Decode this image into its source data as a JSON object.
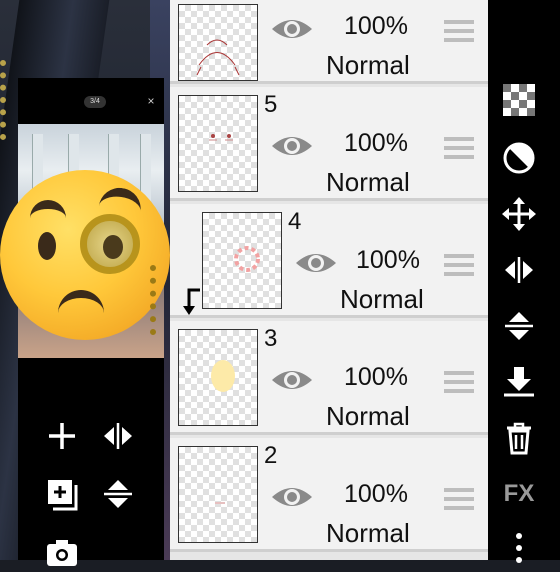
{
  "popup": {
    "counter": "3/4",
    "close_symbol": "×"
  },
  "layers": [
    {
      "number": "",
      "opacity": "100%",
      "blend": "Normal",
      "icon": "eye-icon"
    },
    {
      "number": "5",
      "opacity": "100%",
      "blend": "Normal",
      "icon": "eye-icon"
    },
    {
      "number": "4",
      "opacity": "100%",
      "blend": "Normal",
      "icon": "eye-icon",
      "clipped": true
    },
    {
      "number": "3",
      "opacity": "100%",
      "blend": "Normal",
      "icon": "eye-icon"
    },
    {
      "number": "2",
      "opacity": "100%",
      "blend": "Normal",
      "icon": "eye-icon"
    }
  ],
  "sidebar": {
    "fx_label": "FX",
    "icons": [
      "checkerboard-icon",
      "circle-half-icon",
      "move-icon",
      "flip-horizontal-icon",
      "flip-vertical-icon",
      "merge-down-icon",
      "trash-icon",
      "fx-icon",
      "more-icon"
    ]
  },
  "tools": {
    "icons": [
      "add-layer-icon",
      "flip-horizontal-icon",
      "add-folder-icon",
      "flip-vertical-icon",
      "camera-icon"
    ]
  },
  "colors": {
    "panel_bg": "#f2f2f2",
    "sidebar_bg": "#000000",
    "emoji_yellow": "#ffc83a"
  }
}
